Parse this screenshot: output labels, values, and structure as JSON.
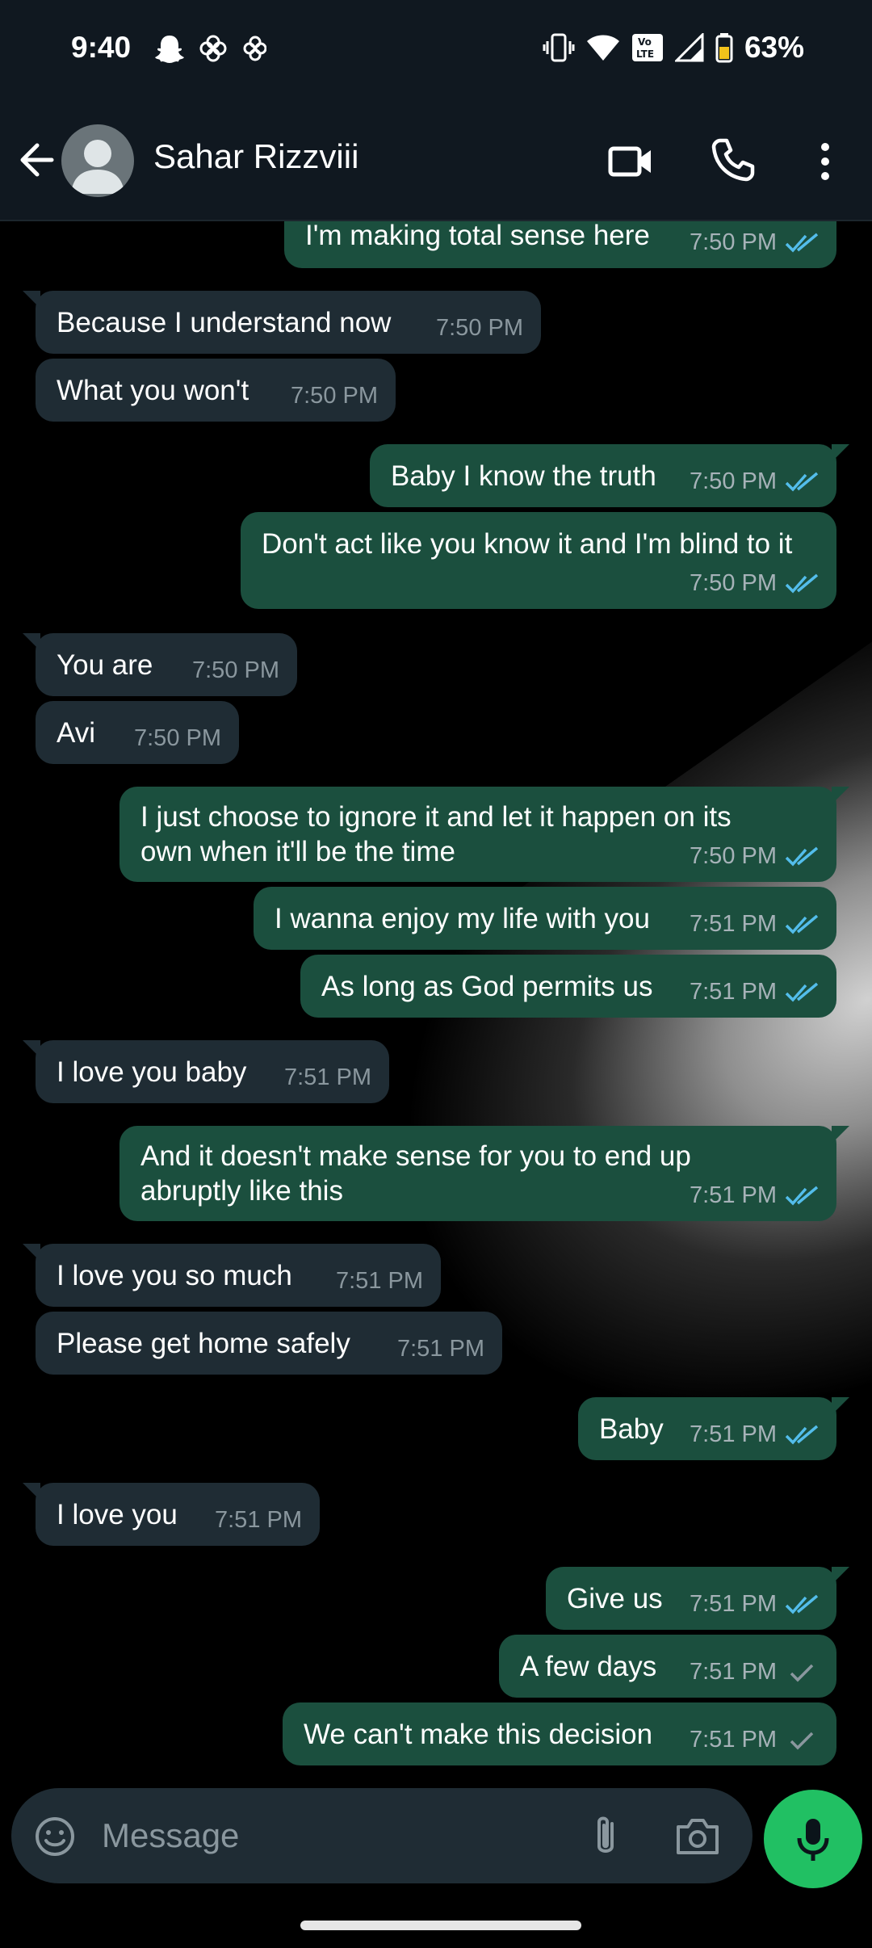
{
  "status_bar": {
    "time": "9:40",
    "battery": "63%",
    "left_icons": [
      "snapchat-icon",
      "flower-icon",
      "flower-icon"
    ],
    "right_icons": [
      "vibrate-icon",
      "wifi-icon",
      "volte-icon",
      "signal-icon",
      "battery-icon"
    ]
  },
  "header": {
    "contact_name": "Sahar Rizzviii"
  },
  "messages": [
    {
      "dir": "out",
      "text": "I'm making total sense here",
      "time": "7:50 PM",
      "status": "read"
    },
    {
      "dir": "in",
      "text": "Because I understand now",
      "time": "7:50 PM"
    },
    {
      "dir": "in",
      "text": "What you won't",
      "time": "7:50 PM"
    },
    {
      "dir": "out",
      "text": "Baby I know the truth",
      "time": "7:50 PM",
      "status": "read"
    },
    {
      "dir": "out",
      "text": "Don't act like you know it and I'm blind to it",
      "time": "7:50 PM",
      "status": "read"
    },
    {
      "dir": "in",
      "text": "You are",
      "time": "7:50 PM"
    },
    {
      "dir": "in",
      "text": "Avi",
      "time": "7:50 PM"
    },
    {
      "dir": "out",
      "text_lines": [
        "I just choose to ignore it and let it happen on its",
        "own when it'll be the time"
      ],
      "time": "7:50 PM",
      "status": "read"
    },
    {
      "dir": "out",
      "text": "I wanna enjoy my life with you",
      "time": "7:51 PM",
      "status": "read"
    },
    {
      "dir": "out",
      "text": "As long as God permits us",
      "time": "7:51 PM",
      "status": "read"
    },
    {
      "dir": "in",
      "text": "I love you baby",
      "time": "7:51 PM"
    },
    {
      "dir": "out",
      "text_lines": [
        "And it doesn't make sense for you to end up",
        "abruptly like this"
      ],
      "time": "7:51 PM",
      "status": "read"
    },
    {
      "dir": "in",
      "text": "I love you so much",
      "time": "7:51 PM"
    },
    {
      "dir": "in",
      "text": "Please get home safely",
      "time": "7:51 PM"
    },
    {
      "dir": "out",
      "text": "Baby",
      "time": "7:51 PM",
      "status": "read"
    },
    {
      "dir": "in",
      "text": "I love you",
      "time": "7:51 PM"
    },
    {
      "dir": "out",
      "text": "Give us",
      "time": "7:51 PM",
      "status": "read"
    },
    {
      "dir": "out",
      "text": "A few days",
      "time": "7:51 PM",
      "status": "sent"
    },
    {
      "dir": "out",
      "text": "We can't make this decision",
      "time": "7:51 PM",
      "status": "sent"
    }
  ],
  "composer": {
    "placeholder": "Message"
  },
  "colors": {
    "incoming_bubble": "#1f2c34",
    "outgoing_bubble": "#1b4f3e",
    "read_tick": "#53bdeb",
    "sent_tick": "#8a979e",
    "mic_button": "#21c063"
  }
}
